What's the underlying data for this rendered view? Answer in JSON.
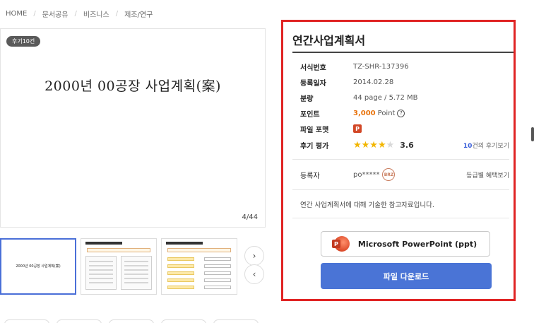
{
  "breadcrumb": [
    "HOME",
    "문서공유",
    "비즈니스",
    "제조/연구"
  ],
  "preview": {
    "review_badge": "후기10건",
    "doc_title": "2000년 00공장 사업계획(案)",
    "page_indicator": "4/44"
  },
  "thumbnails": {
    "first_title": "2000년 00공장 사업계획(案)"
  },
  "info": {
    "title": "연간사업계획서",
    "rows": [
      {
        "key": "서식번호",
        "value": "TZ-SHR-137396"
      },
      {
        "key": "등록일자",
        "value": "2014.02.28"
      },
      {
        "key": "분량",
        "value": "44 page / 5.72 MB"
      }
    ],
    "point_key": "포인트",
    "point_value": "3,000",
    "point_unit": "Point",
    "point_help": "?",
    "format_key": "파일 포맷",
    "format_badge": "P",
    "rating_key": "후기 평가",
    "rating_value": "3.6",
    "rating_stars": 3.6,
    "review_count": "10",
    "review_suffix": "건의 후기보기",
    "registrant_key": "등록자",
    "registrant_value": "po*****",
    "registrant_badge": "BRZ",
    "benefit_link": "등급별 혜택보기",
    "description": "연간 사업계획서에 대해 기술한 참고자료입니다.",
    "app_button": "Microsoft PowerPoint (ppt)",
    "download_button": "파일 다운로드"
  },
  "nav": {
    "next": "›",
    "prev": "‹"
  },
  "colors": {
    "highlight_border": "#e02424",
    "download": "#4a74d6",
    "point": "#e8730c",
    "star": "#f2b600"
  }
}
